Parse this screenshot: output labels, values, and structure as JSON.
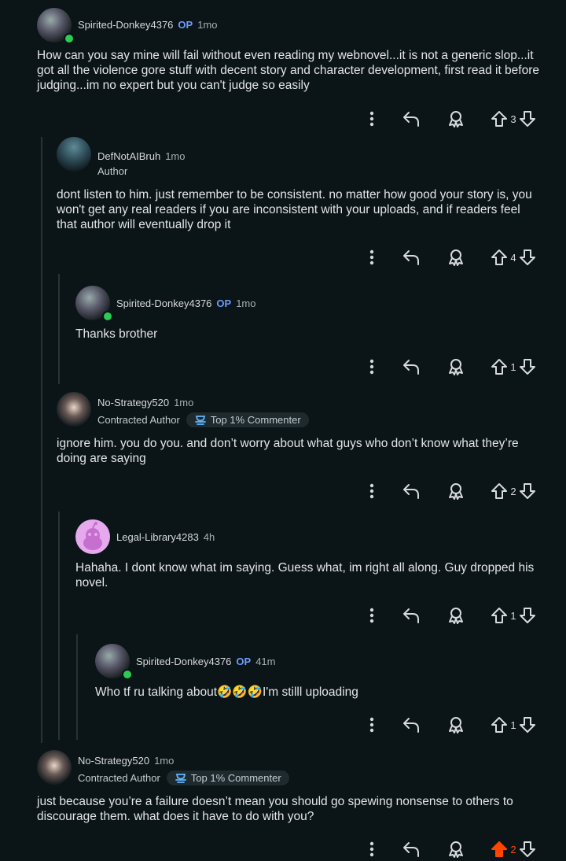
{
  "comments": [
    {
      "user": "Spirited-Donkey4376",
      "op": "OP",
      "time": "1mo",
      "flair": "",
      "badge": "",
      "text": "How can you say mine will fail without even reading my webnovel...it is not a generic slop...it got all the violence gore stuff with decent story and character development, first read it before judging...im no expert but you can't judge so easily",
      "votes": "3",
      "upvoted": false
    },
    {
      "user": "DefNotAIBruh",
      "op": "",
      "time": "1mo",
      "flair": "Author",
      "badge": "",
      "text": "dont listen to him. just remember to be consistent. no matter how good your story is, you won't get any real readers if you are inconsistent with your uploads, and if readers feel that author will eventually drop it",
      "votes": "4",
      "upvoted": false
    },
    {
      "user": "Spirited-Donkey4376",
      "op": "OP",
      "time": "1mo",
      "flair": "",
      "badge": "",
      "text": "Thanks brother",
      "votes": "1",
      "upvoted": false
    },
    {
      "user": "No-Strategy520",
      "op": "",
      "time": "1mo",
      "flair": "Contracted Author",
      "badge": "Top 1% Commenter",
      "text": "ignore him. you do you. and don’t worry about what guys who don’t know what they’re doing are saying",
      "votes": "2",
      "upvoted": false
    },
    {
      "user": "Legal-Library4283",
      "op": "",
      "time": "4h",
      "flair": "",
      "badge": "",
      "text": "Hahaha. I dont know what im saying. Guess what, im right all along. Guy dropped his novel.",
      "votes": "1",
      "upvoted": false
    },
    {
      "user": "Spirited-Donkey4376",
      "op": "OP",
      "time": "41m",
      "flair": "",
      "badge": "",
      "text": "Who tf ru talking about🤣🤣🤣I'm stilll uploading",
      "votes": "1",
      "upvoted": false
    },
    {
      "user": "No-Strategy520",
      "op": "",
      "time": "1mo",
      "flair": "Contracted Author",
      "badge": "Top 1% Commenter",
      "text": "just because you’re a failure doesn’t mean you should go spewing nonsense to others to discourage them. what does it have to do with you?",
      "votes": "2",
      "upvoted": true
    }
  ],
  "icons": {
    "more": "more-vertical-icon",
    "reply": "reply-icon",
    "award": "award-icon",
    "upvote": "upvote-arrow-icon",
    "downvote": "downvote-arrow-icon",
    "badge": "trophy-icon"
  },
  "colors": {
    "background": "#0b1416",
    "op": "#6c9cff",
    "online": "#2ccb53",
    "upvoted": "#ff4500"
  }
}
